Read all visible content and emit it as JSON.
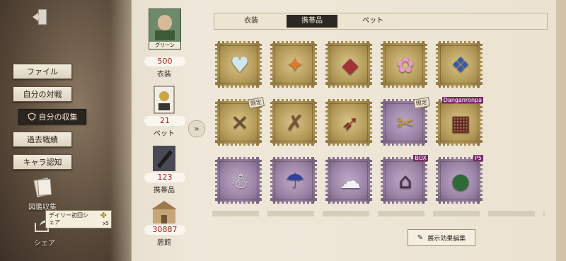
{
  "nav": {
    "items": [
      {
        "label": "ファイル",
        "active": false
      },
      {
        "label": "自分の対戦",
        "active": false
      },
      {
        "label": "自分の収集",
        "active": true
      },
      {
        "label": "過去戦績",
        "active": false
      },
      {
        "label": "キャラ認知",
        "active": false
      }
    ],
    "codex_label": "図鑑収集",
    "share_label": "シェア",
    "tooltip_line1": "デイリー初回シ",
    "tooltip_line2": "ェア",
    "tooltip_reward": "x5"
  },
  "stats": [
    {
      "pic_label": "グリーン",
      "value": "500",
      "label": "衣装"
    },
    {
      "value": "21",
      "label": "ペット"
    },
    {
      "value": "123",
      "label": "携帯品"
    },
    {
      "value": "30887",
      "label": "居館"
    }
  ],
  "tabs": [
    {
      "label": "衣装",
      "active": false
    },
    {
      "label": "携帯品",
      "active": true
    },
    {
      "label": "ペット",
      "active": false
    }
  ],
  "stamps": [
    {
      "style": "gold",
      "icon": "crystal-heart-icon"
    },
    {
      "style": "gold",
      "icon": "flaming-staff-icon"
    },
    {
      "style": "gold",
      "icon": "gem-box-icon"
    },
    {
      "style": "gold",
      "icon": "pink-orb-icon"
    },
    {
      "style": "gold",
      "icon": "blue-flame-crystal-icon"
    },
    {
      "style": "gold",
      "icon": "winged-crossbow-icon",
      "badge": "限定"
    },
    {
      "style": "gold",
      "icon": "scroll-crossbow-icon"
    },
    {
      "style": "gold",
      "icon": "spear-lantern-icon"
    },
    {
      "style": "purple",
      "icon": "golden-crossbow-icon",
      "badge": "限定"
    },
    {
      "style": "gold",
      "icon": "slot-machine-icon",
      "logo": "Danganronpa"
    },
    {
      "style": "purple",
      "icon": "ghost-hat-icon"
    },
    {
      "style": "purple",
      "icon": "blue-umbrella-icon"
    },
    {
      "style": "purple",
      "icon": "ghost-icon"
    },
    {
      "style": "purple",
      "icon": "dark-shrine-icon",
      "logo": "BOX"
    },
    {
      "style": "purple",
      "icon": "green-orb-icon",
      "logo": "P5"
    }
  ],
  "edit_button": "展示効果編集",
  "colors": {
    "accent_red": "#a82424",
    "dark_tab": "#2d2823",
    "paper": "#ebe2d1"
  }
}
